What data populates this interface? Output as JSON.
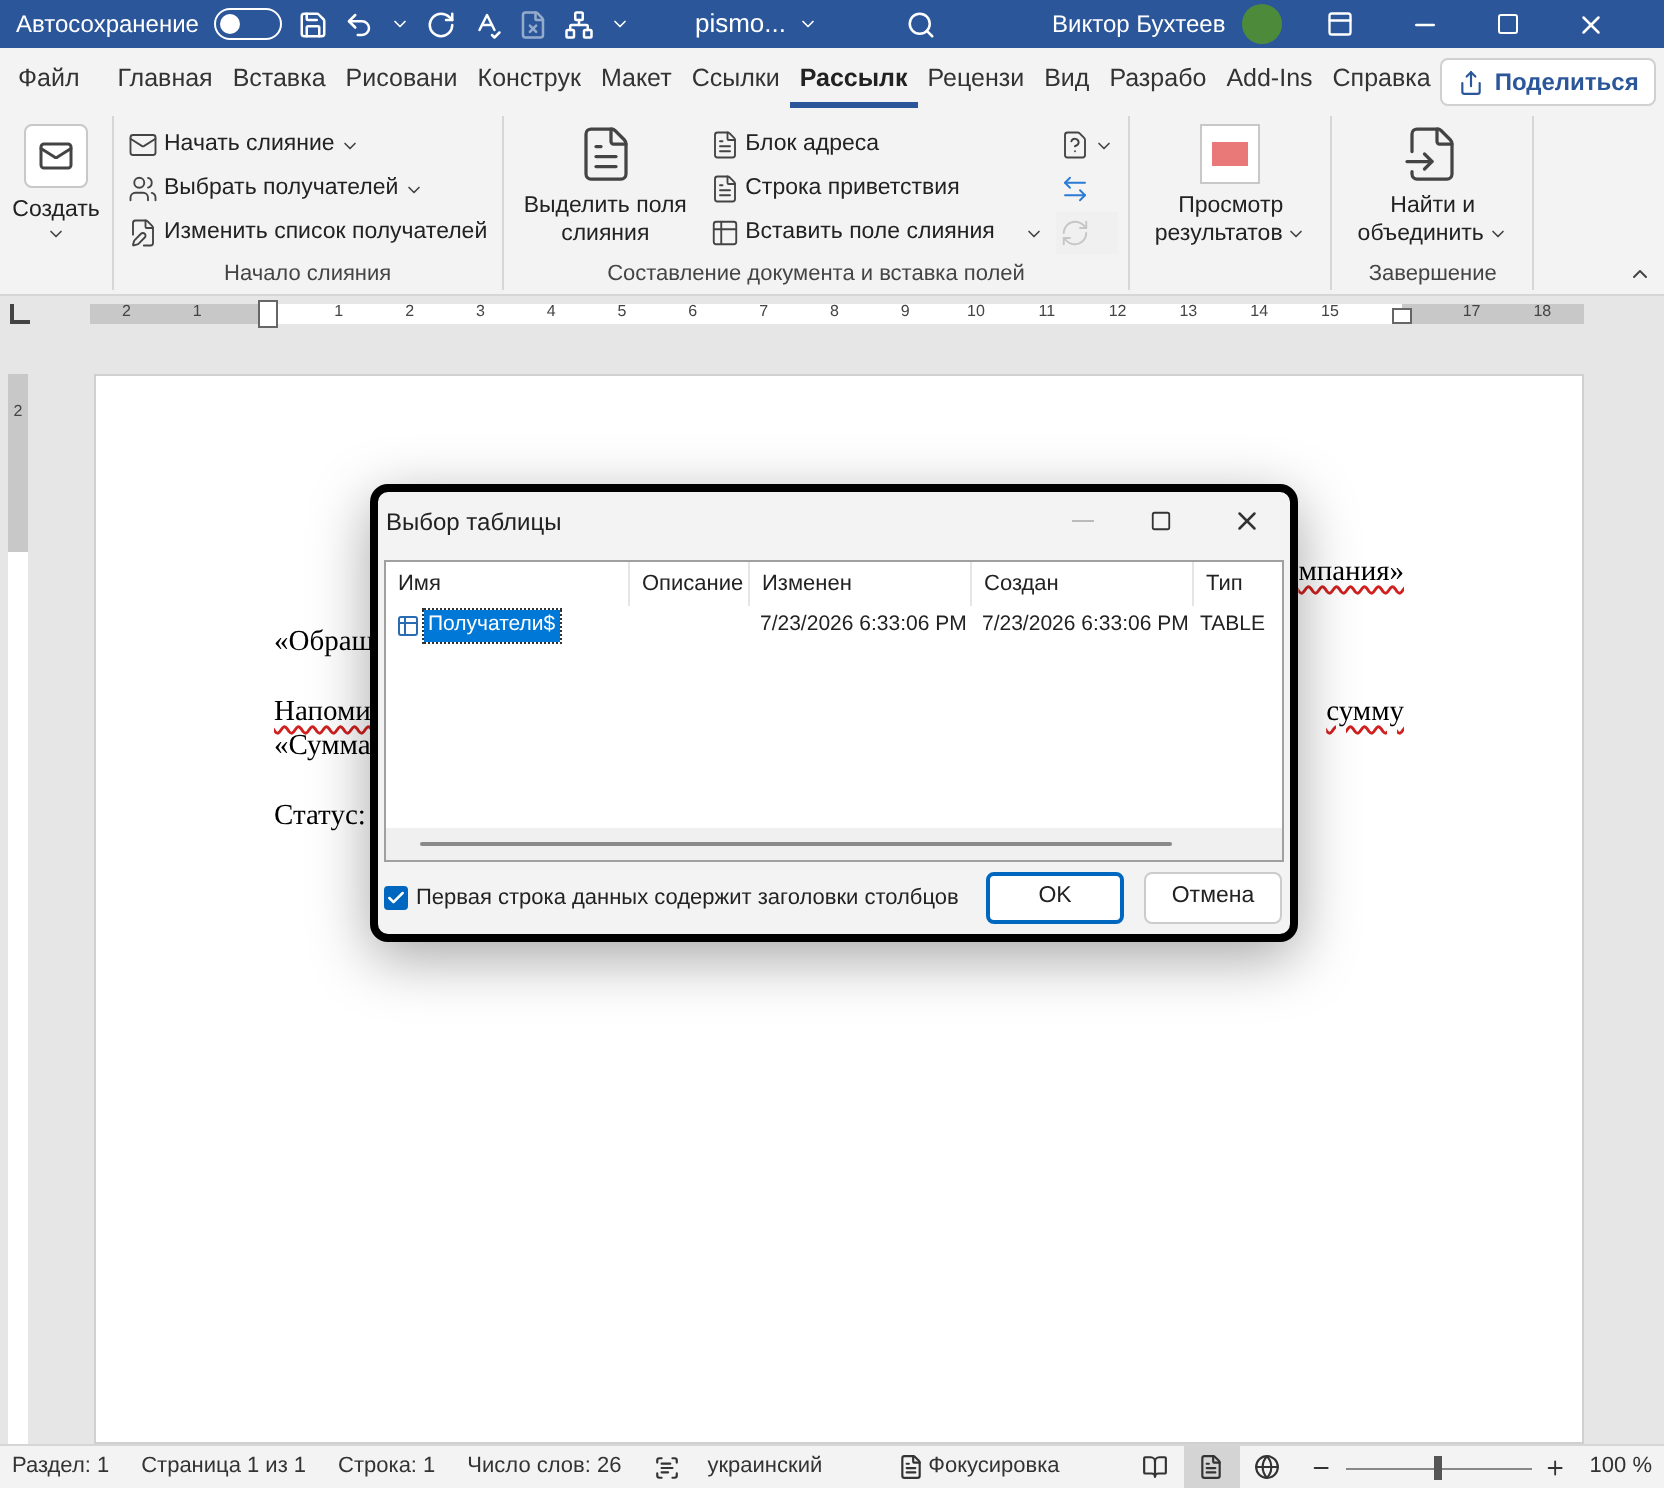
{
  "title_bar": {
    "autosave_label": "Автосохранение",
    "autosave_on": false,
    "file_name": "pismo...",
    "user_name": "Виктор Бухтеев"
  },
  "tabs": [
    {
      "label": "Файл",
      "selected": false
    },
    {
      "label": "Главная",
      "selected": false
    },
    {
      "label": "Вставка",
      "selected": false
    },
    {
      "label": "Рисовани",
      "selected": false
    },
    {
      "label": "Конструк",
      "selected": false
    },
    {
      "label": "Макет",
      "selected": false
    },
    {
      "label": "Ссылки",
      "selected": false
    },
    {
      "label": "Рассылк",
      "selected": true
    },
    {
      "label": "Рецензи",
      "selected": false
    },
    {
      "label": "Вид",
      "selected": false
    },
    {
      "label": "Разрабо",
      "selected": false
    },
    {
      "label": "Add-Ins",
      "selected": false
    },
    {
      "label": "Справка",
      "selected": false
    }
  ],
  "share_button": "Поделиться",
  "ribbon": {
    "groups": [
      {
        "items": [
          {
            "kind": "large",
            "label": "Создать",
            "dropdown": true
          }
        ]
      },
      {
        "label": "Начало слияния",
        "items": [
          {
            "kind": "small",
            "label": "Начать слияние",
            "dropdown": true
          },
          {
            "kind": "small",
            "label": "Выбрать получателей",
            "dropdown": true
          },
          {
            "kind": "small",
            "label": "Изменить список получателей",
            "dropdown": false
          }
        ]
      },
      {
        "label": "Составление документа и вставка полей",
        "items": [
          {
            "kind": "large",
            "label": "Выделить поля слияния",
            "dropdown": false,
            "disabled": false
          },
          {
            "kind": "small",
            "label": "Блок адреса",
            "dropdown": false,
            "disabled": false
          },
          {
            "kind": "small",
            "label": "Строка приветствия",
            "dropdown": false,
            "disabled": false
          },
          {
            "kind": "small",
            "label": "Вставить поле слияния",
            "dropdown": true,
            "disabled": false
          },
          {
            "kind": "icon",
            "dropdown": true,
            "disabled": false
          },
          {
            "kind": "icon",
            "dropdown": false,
            "disabled": false
          },
          {
            "kind": "icon",
            "dropdown": false,
            "disabled": true
          }
        ]
      },
      {
        "items": [
          {
            "kind": "large",
            "label": "Просмотр результатов",
            "dropdown": true
          }
        ]
      },
      {
        "label": "Завершение",
        "items": [
          {
            "kind": "large",
            "label": "Найти и объединить",
            "dropdown": true
          }
        ]
      }
    ]
  },
  "ruler": {
    "labels": [
      "2",
      "1",
      "1",
      "2",
      "3",
      "4",
      "5",
      "6",
      "7",
      "8",
      "9",
      "10",
      "11",
      "12",
      "13",
      "14",
      "15",
      "17",
      "18"
    ],
    "vertical_labels": [
      "2"
    ]
  },
  "document": {
    "lines": [
      {
        "right": {
          "text": "мпания»",
          "misspelled": true
        }
      },
      {
        "left": {
          "text": "«Обращ",
          "misspelled": false
        }
      },
      {
        "left": {
          "text": "Напоми",
          "misspelled": true
        },
        "right": {
          "text": "сумму",
          "misspelled": true
        }
      },
      {
        "left": {
          "text": "«Сумма",
          "misspelled": false
        }
      },
      {
        "left": {
          "text": "Статус:",
          "misspelled": false
        }
      }
    ]
  },
  "dialog": {
    "title": "Выбор таблицы",
    "table": {
      "columns": [
        "Имя",
        "Описание",
        "Изменен",
        "Создан",
        "Тип"
      ],
      "rows": [
        {
          "cells": [
            "Получатели$",
            "",
            "7/23/2026 6:33:06 PM",
            "7/23/2026 6:33:06 PM",
            "TABLE"
          ],
          "selected": true
        }
      ]
    },
    "header_checkbox": {
      "label": "Первая строка данных содержит заголовки столбцов",
      "checked": true
    },
    "buttons": [
      {
        "label": "OK",
        "default": true
      },
      {
        "label": "Отмена",
        "default": false
      }
    ]
  },
  "status_bar": {
    "items": [
      "Раздел: 1",
      "Страница 1 из 1",
      "Строка: 1",
      "Число слов: 26"
    ],
    "language": "украинский",
    "focus": "Фокусировка",
    "views": [
      {
        "selected": false
      },
      {
        "selected": true
      },
      {
        "selected": false
      }
    ],
    "zoom": {
      "level": 0.5,
      "reading": "100 %"
    }
  }
}
